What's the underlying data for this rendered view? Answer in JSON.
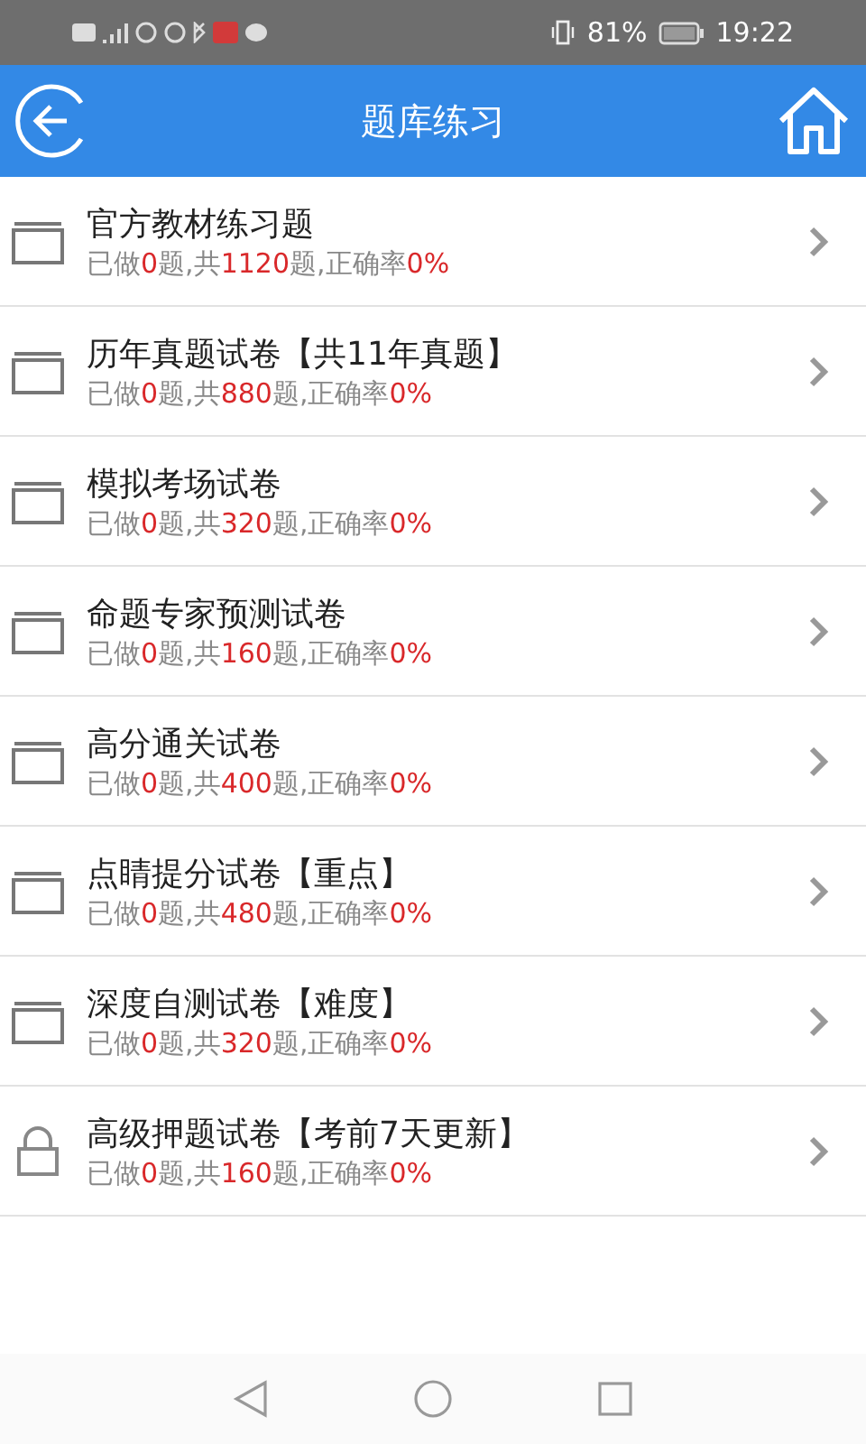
{
  "status_bar": {
    "battery": "81%",
    "time": "19:22"
  },
  "header": {
    "title": "题库练习"
  },
  "items": [
    {
      "kind": "folder",
      "title": "官方教材练习题",
      "stats": [
        {
          "kind": "label",
          "text": "已做"
        },
        {
          "kind": "value",
          "text": "0"
        },
        {
          "kind": "label",
          "text": "题,共"
        },
        {
          "kind": "value",
          "text": "1120"
        },
        {
          "kind": "label",
          "text": "题,正确率"
        },
        {
          "kind": "value",
          "text": "0%"
        }
      ]
    },
    {
      "kind": "folder",
      "title": "历年真题试卷【共11年真题】",
      "stats": [
        {
          "kind": "label",
          "text": "已做"
        },
        {
          "kind": "value",
          "text": "0"
        },
        {
          "kind": "label",
          "text": "题,共"
        },
        {
          "kind": "value",
          "text": "880"
        },
        {
          "kind": "label",
          "text": "题,正确率"
        },
        {
          "kind": "value",
          "text": "0%"
        }
      ]
    },
    {
      "kind": "folder",
      "title": "模拟考场试卷",
      "stats": [
        {
          "kind": "label",
          "text": "已做"
        },
        {
          "kind": "value",
          "text": "0"
        },
        {
          "kind": "label",
          "text": "题,共"
        },
        {
          "kind": "value",
          "text": "320"
        },
        {
          "kind": "label",
          "text": "题,正确率"
        },
        {
          "kind": "value",
          "text": "0%"
        }
      ]
    },
    {
      "kind": "folder",
      "title": "命题专家预测试卷",
      "stats": [
        {
          "kind": "label",
          "text": "已做"
        },
        {
          "kind": "value",
          "text": "0"
        },
        {
          "kind": "label",
          "text": "题,共"
        },
        {
          "kind": "value",
          "text": "160"
        },
        {
          "kind": "label",
          "text": "题,正确率"
        },
        {
          "kind": "value",
          "text": "0%"
        }
      ]
    },
    {
      "kind": "folder",
      "title": "高分通关试卷",
      "stats": [
        {
          "kind": "label",
          "text": "已做"
        },
        {
          "kind": "value",
          "text": "0"
        },
        {
          "kind": "label",
          "text": "题,共"
        },
        {
          "kind": "value",
          "text": "400"
        },
        {
          "kind": "label",
          "text": "题,正确率"
        },
        {
          "kind": "value",
          "text": "0%"
        }
      ]
    },
    {
      "kind": "folder",
      "title": "点睛提分试卷【重点】",
      "stats": [
        {
          "kind": "label",
          "text": "已做"
        },
        {
          "kind": "value",
          "text": "0"
        },
        {
          "kind": "label",
          "text": "题,共"
        },
        {
          "kind": "value",
          "text": "480"
        },
        {
          "kind": "label",
          "text": "题,正确率"
        },
        {
          "kind": "value",
          "text": "0%"
        }
      ]
    },
    {
      "kind": "folder",
      "title": "深度自测试卷【难度】",
      "stats": [
        {
          "kind": "label",
          "text": "已做"
        },
        {
          "kind": "value",
          "text": "0"
        },
        {
          "kind": "label",
          "text": "题,共"
        },
        {
          "kind": "value",
          "text": "320"
        },
        {
          "kind": "label",
          "text": "题,正确率"
        },
        {
          "kind": "value",
          "text": "0%"
        }
      ]
    },
    {
      "kind": "locked",
      "title": "高级押题试卷【考前7天更新】",
      "stats": [
        {
          "kind": "label",
          "text": "已做"
        },
        {
          "kind": "value",
          "text": "0"
        },
        {
          "kind": "label",
          "text": "题,共"
        },
        {
          "kind": "value",
          "text": "160"
        },
        {
          "kind": "label",
          "text": "题,正确率"
        },
        {
          "kind": "value",
          "text": "0%"
        }
      ]
    }
  ]
}
